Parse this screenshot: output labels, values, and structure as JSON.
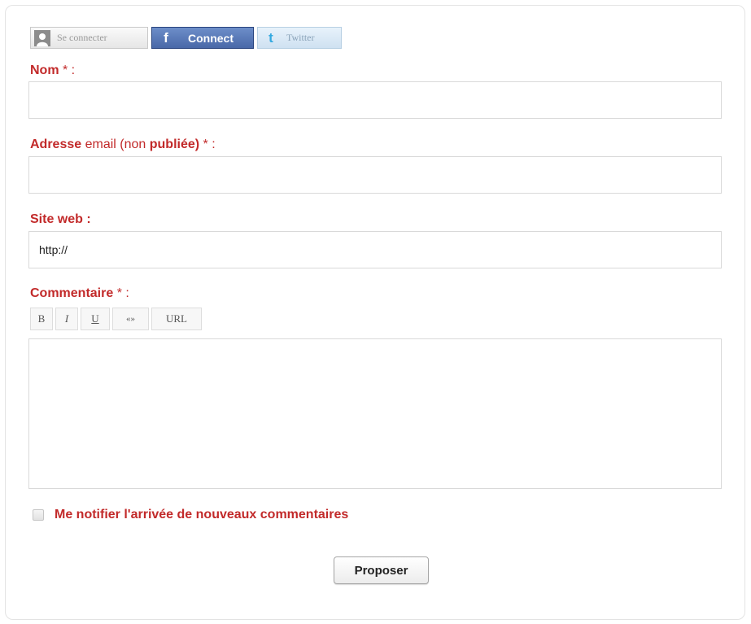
{
  "login": {
    "connect_label": "Se connecter",
    "facebook_icon": "f",
    "facebook_label": "Connect",
    "twitter_icon": "t",
    "twitter_label": "Twitter"
  },
  "form": {
    "name_label": "Nom",
    "name_required": " * :",
    "name_value": "",
    "email_label_a": "Adresse",
    "email_label_b": " email (non ",
    "email_label_c": "publiée)",
    "email_required": " * :",
    "email_value": "",
    "site_label": "Site web :",
    "site_value": "http://",
    "comment_label": "Commentaire",
    "comment_required": " * :",
    "comment_value": "",
    "toolbar": [
      "B",
      "I",
      "U",
      "«»",
      "URL"
    ],
    "notify_label_a": "Me notifier l'arrivée de ",
    "notify_label_b": "nouveaux commentaires",
    "notify_checked": false,
    "submit_label": "Proposer"
  },
  "colors": {
    "label_red": "#c22a2a",
    "facebook_blue": "#4968a8",
    "twitter_blue": "#33a9e0"
  }
}
